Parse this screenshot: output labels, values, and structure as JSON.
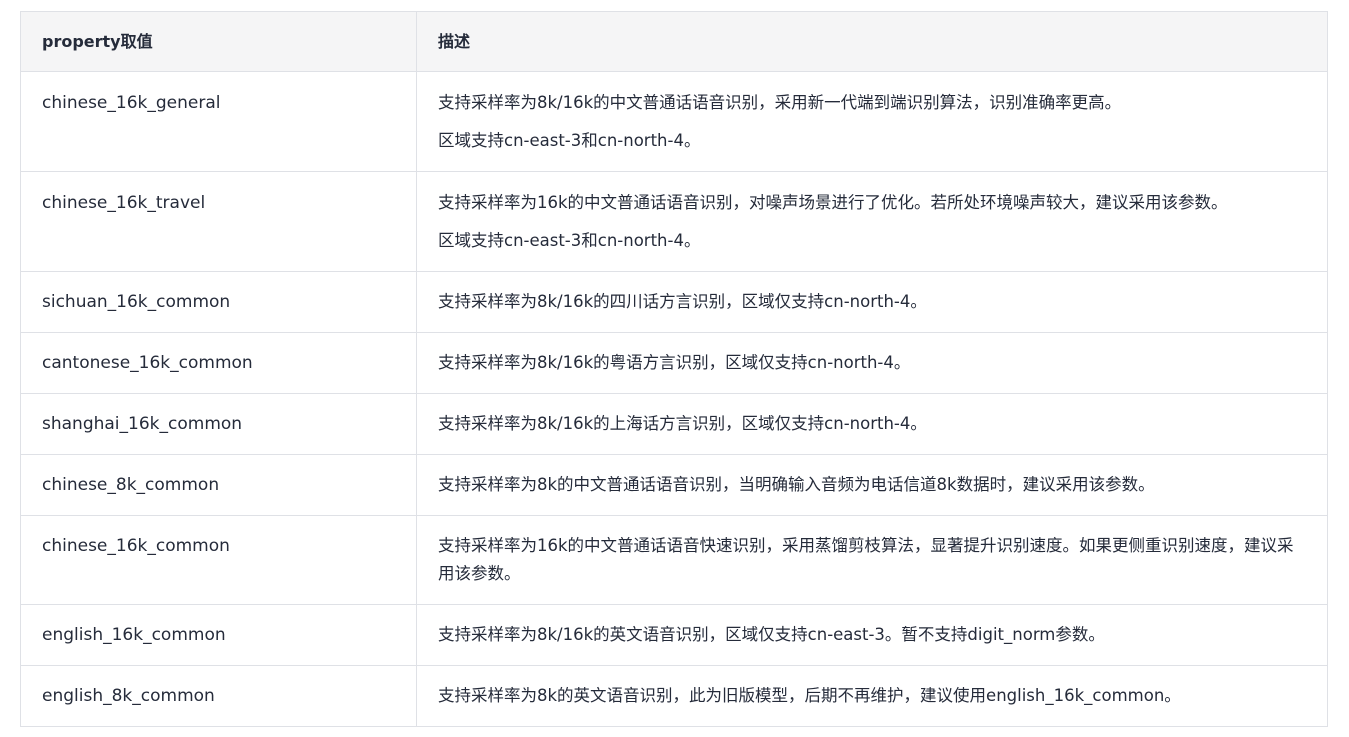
{
  "table": {
    "headers": [
      "property取值",
      "描述"
    ],
    "rows": [
      {
        "property": "chinese_16k_general",
        "description": [
          "支持采样率为8k/16k的中文普通话语音识别，采用新一代端到端识别算法，识别准确率更高。",
          "区域支持cn-east-3和cn-north-4。"
        ]
      },
      {
        "property": "chinese_16k_travel",
        "description": [
          "支持采样率为16k的中文普通话语音识别，对噪声场景进行了优化。若所处环境噪声较大，建议采用该参数。",
          "区域支持cn-east-3和cn-north-4。"
        ]
      },
      {
        "property": "sichuan_16k_common",
        "description": [
          "支持采样率为8k/16k的四川话方言识别，区域仅支持cn-north-4。"
        ]
      },
      {
        "property": "cantonese_16k_common",
        "description": [
          "支持采样率为8k/16k的粤语方言识别，区域仅支持cn-north-4。"
        ]
      },
      {
        "property": "shanghai_16k_common",
        "description": [
          "支持采样率为8k/16k的上海话方言识别，区域仅支持cn-north-4。"
        ]
      },
      {
        "property": "chinese_8k_common",
        "description": [
          "支持采样率为8k的中文普通话语音识别，当明确输入音频为电话信道8k数据时，建议采用该参数。"
        ]
      },
      {
        "property": "chinese_16k_common",
        "description": [
          "支持采样率为16k的中文普通话语音快速识别，采用蒸馏剪枝算法，显著提升识别速度。如果更侧重识别速度，建议采用该参数。"
        ]
      },
      {
        "property": "english_16k_common",
        "description": [
          "支持采样率为8k/16k的英文语音识别，区域仅支持cn-east-3。暂不支持digit_norm参数。"
        ]
      },
      {
        "property": "english_8k_common",
        "description": [
          "支持采样率为8k的英文语音识别，此为旧版模型，后期不再维护，建议使用english_16k_common。"
        ]
      }
    ]
  }
}
